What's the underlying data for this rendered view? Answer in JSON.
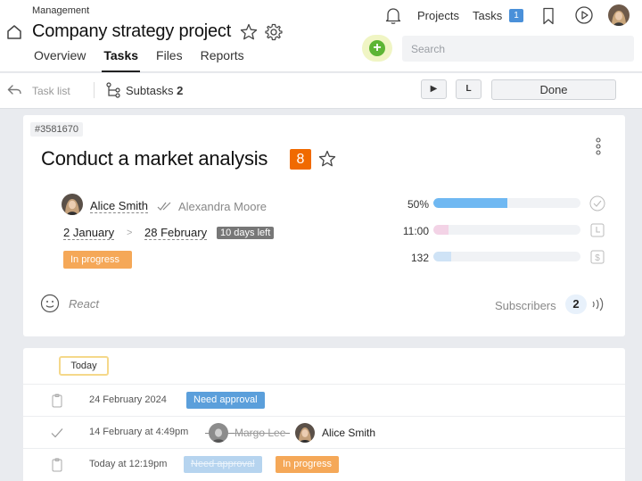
{
  "header": {
    "breadcrumb": "Management",
    "project_title": "Company strategy project",
    "tabs": [
      {
        "label": "Overview"
      },
      {
        "label": "Tasks"
      },
      {
        "label": "Files"
      },
      {
        "label": "Reports"
      }
    ],
    "nav": {
      "projects_label": "Projects",
      "tasks_label": "Tasks",
      "tasks_count": "1"
    },
    "add_label": "+",
    "search_placeholder": "Search"
  },
  "toolbar": {
    "task_list_label": "Task list",
    "subtasks_label": "Subtasks",
    "subtasks_count": "2",
    "play_label": "▶",
    "l_label": "L",
    "done_label": "Done"
  },
  "task": {
    "id": "#3581670",
    "title": "Conduct a market analysis",
    "priority": "8",
    "assignee": "Alice Smith",
    "coassignee": "Alexandra Moore",
    "date_start": "2 January",
    "date_sep": ">",
    "date_end": "28 February",
    "days_left": "10 days left",
    "status": "In progress",
    "metrics": [
      {
        "label": "50%",
        "fill": 0.5,
        "color": "#6fb8f2"
      },
      {
        "label": "11:00",
        "fill": 0.1,
        "color": "#f3d3e6"
      },
      {
        "label": "132",
        "fill": 0.12,
        "color": "#cfe3f6"
      }
    ],
    "react_label": "React",
    "subscribers_label": "Subscribers",
    "subscribers_count": "2"
  },
  "feed": {
    "today_label": "Today",
    "rows": [
      {
        "time": "24 February 2024",
        "chip": "Need approval"
      },
      {
        "time": "14 February at 4:49pm",
        "from_name": "Margo Lee",
        "to_name": "Alice Smith"
      },
      {
        "time": "Today at 12:19pm",
        "chip_from": "Need approval",
        "chip_to": "In progress"
      }
    ]
  },
  "colors": {
    "accent_blue": "#4a90d9",
    "priority_orange": "#f06a00",
    "status_orange": "#f5a858",
    "add_green": "#5db534"
  }
}
